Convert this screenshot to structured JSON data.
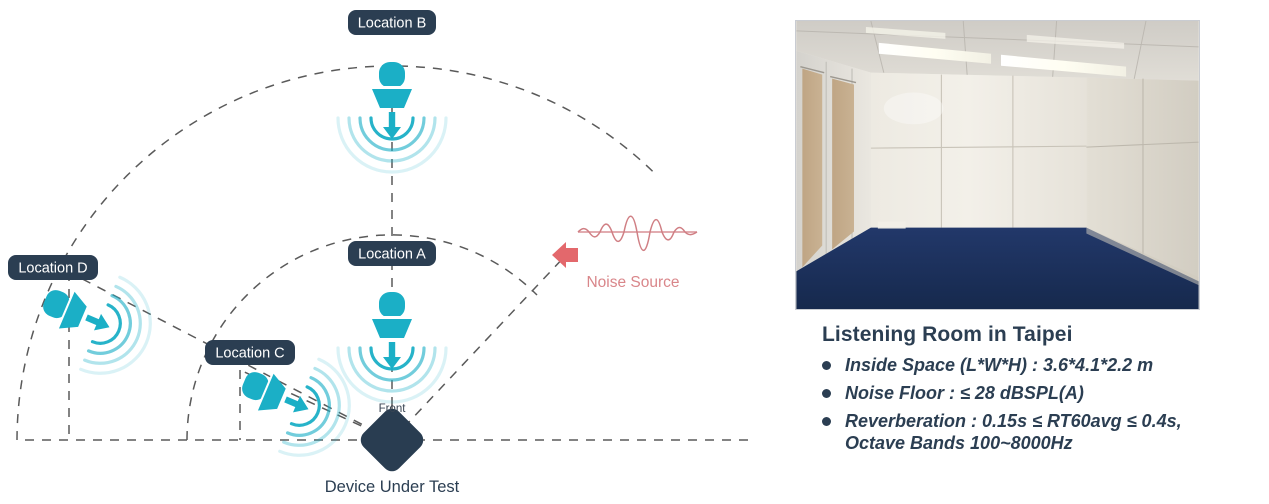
{
  "diagram": {
    "locations": [
      {
        "id": "A",
        "label": "Location A"
      },
      {
        "id": "B",
        "label": "Location B"
      },
      {
        "id": "C",
        "label": "Location C"
      },
      {
        "id": "D",
        "label": "Location D"
      }
    ],
    "noise_source_label": "Noise Source",
    "dut_label": "Device Under Test",
    "front_label": "Front",
    "colors": {
      "speaker_teal": "#1BAFC6",
      "badge_navy": "#2B3E52",
      "dut_navy": "#293D51",
      "noise_red": "#E3686C",
      "noise_text": "#D9868A",
      "dashed_gray": "#5A5A5A"
    }
  },
  "photo": {
    "alt": "listening-room-interior",
    "wall_color": "#EDE9E0",
    "floor_color": "#1E3560",
    "panel_color": "#C2A98B",
    "ceiling_color": "#D8D5CE",
    "light_color": "#FDFDF6"
  },
  "caption": {
    "title": "Listening Room in Taipei",
    "specs": [
      {
        "line1": "Inside Space (L*W*H) : 3.6*4.1*2.2 m",
        "line2": ""
      },
      {
        "line1": "Noise Floor : ≤ 28 dBSPL(A)",
        "line2": ""
      },
      {
        "line1": "Reverberation : 0.15s ≤ RT60avg ≤ 0.4s,",
        "line2": "Octave Bands 100~8000Hz"
      }
    ]
  }
}
